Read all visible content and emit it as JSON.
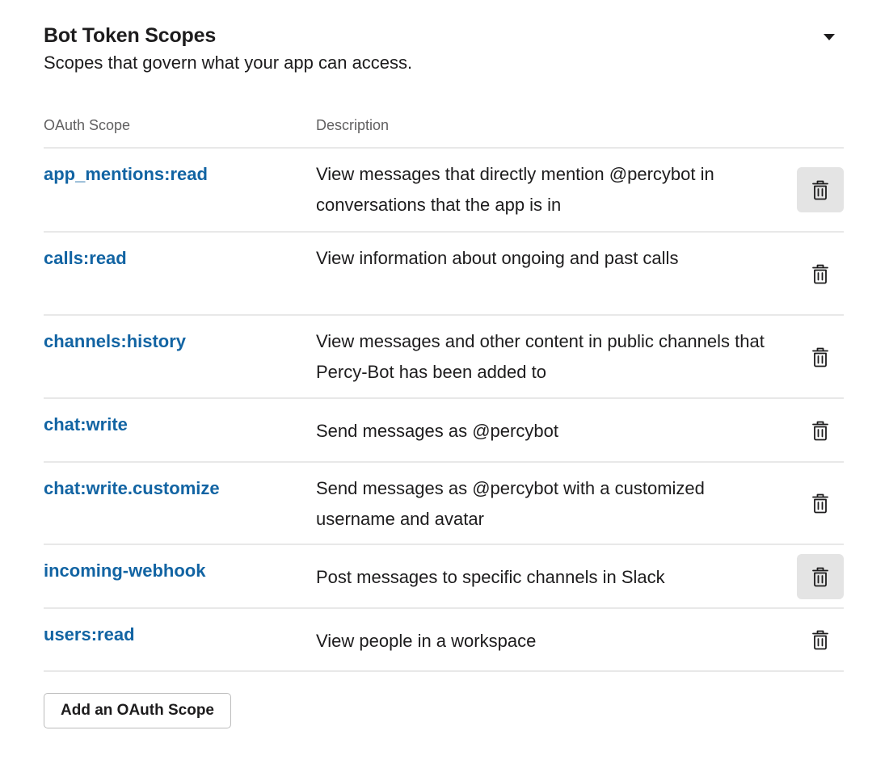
{
  "section": {
    "title": "Bot Token Scopes",
    "subtitle": "Scopes that govern what your app can access."
  },
  "table": {
    "headers": {
      "scope": "OAuth Scope",
      "description": "Description"
    },
    "rows": [
      {
        "scope": "app_mentions:read",
        "description": "View messages that directly mention @percybot in conversations that the app is in",
        "action_icon": "trash-icon",
        "highlighted": true
      },
      {
        "scope": "calls:read",
        "description": "View information about ongoing and past calls",
        "action_icon": "trash-icon",
        "highlighted": false
      },
      {
        "scope": "channels:history",
        "description": "View messages and other content in public channels that Percy-Bot has been added to",
        "action_icon": "trash-icon",
        "highlighted": false
      },
      {
        "scope": "chat:write",
        "description": "Send messages as @percybot",
        "action_icon": "trash-icon",
        "highlighted": false
      },
      {
        "scope": "chat:write.customize",
        "description": "Send messages as @percybot with a customized username and avatar",
        "action_icon": "trash-icon",
        "highlighted": false
      },
      {
        "scope": "incoming-webhook",
        "description": "Post messages to specific channels in Slack",
        "action_icon": "trash-icon",
        "highlighted": true
      },
      {
        "scope": "users:read",
        "description": "View people in a workspace",
        "action_icon": "trash-icon",
        "highlighted": false
      }
    ]
  },
  "actions": {
    "add_scope_label": "Add an OAuth Scope"
  },
  "colors": {
    "scope_link": "#1264a3",
    "text": "#1d1c1d",
    "header_text": "#616061",
    "divider": "#e8e8e8",
    "button_hover_bg": "#e4e4e4"
  }
}
